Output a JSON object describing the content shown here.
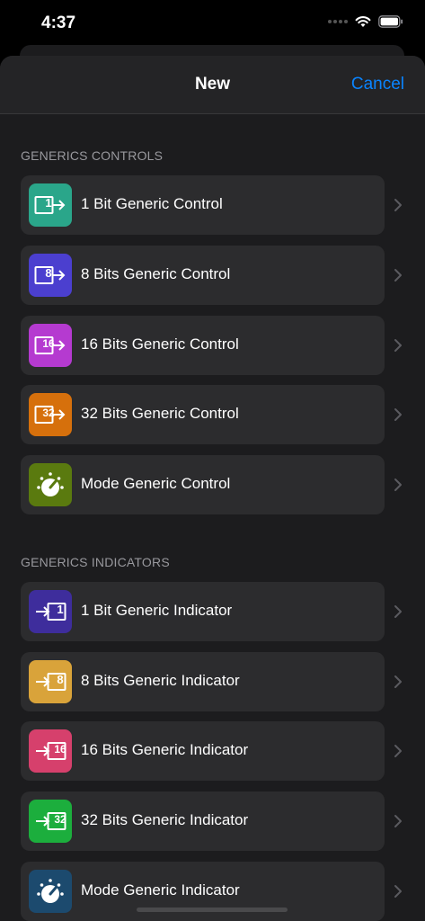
{
  "status": {
    "time": "4:37"
  },
  "nav": {
    "title": "New",
    "cancel": "Cancel"
  },
  "sections": [
    {
      "header": "GENERICS CONTROLS",
      "items": [
        {
          "label": "1 Bit Generic Control",
          "icon": "control-1-icon",
          "badge": "1",
          "color": "#2aa68a"
        },
        {
          "label": "8 Bits Generic Control",
          "icon": "control-8-icon",
          "badge": "8",
          "color": "#4b3fcf"
        },
        {
          "label": "16 Bits Generic Control",
          "icon": "control-16-icon",
          "badge": "16",
          "color": "#b53ad0"
        },
        {
          "label": "32 Bits Generic Control",
          "icon": "control-32-icon",
          "badge": "32",
          "color": "#d6700c"
        },
        {
          "label": "Mode Generic Control",
          "icon": "mode-dial-icon",
          "badge": "",
          "color": "#5a7a0f"
        }
      ]
    },
    {
      "header": "GENERICS INDICATORS",
      "items": [
        {
          "label": "1 Bit Generic Indicator",
          "icon": "indicator-1-icon",
          "badge": "1",
          "color": "#3e2d9c"
        },
        {
          "label": "8 Bits Generic Indicator",
          "icon": "indicator-8-icon",
          "badge": "8",
          "color": "#d9a33a"
        },
        {
          "label": "16 Bits Generic Indicator",
          "icon": "indicator-16-icon",
          "badge": "16",
          "color": "#d6406c"
        },
        {
          "label": "32 Bits Generic Indicator",
          "icon": "indicator-32-icon",
          "badge": "32",
          "color": "#1cae3d"
        },
        {
          "label": "Mode Generic Indicator",
          "icon": "mode-dial-icon",
          "badge": "",
          "color": "#1c4a6e"
        }
      ]
    }
  ]
}
